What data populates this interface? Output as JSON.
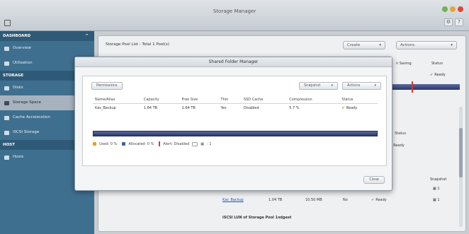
{
  "window": {
    "title": "Storage Manager"
  },
  "sidebar": {
    "dashboard_header": "DASHBOARD",
    "dashboard_items": [
      {
        "label": "Overview",
        "icon": "overview-icon"
      },
      {
        "label": "Utilization",
        "icon": "chart-icon"
      }
    ],
    "storage_header": "STORAGE",
    "storage_items": [
      {
        "label": "Disks",
        "icon": "disk-icon"
      },
      {
        "label": "Storage Space",
        "icon": "storage-icon",
        "active": true
      },
      {
        "label": "Cache Acceleration",
        "icon": "cache-icon"
      },
      {
        "label": "iSCSI Storage",
        "icon": "iscsi-icon"
      }
    ],
    "host_header": "HOST",
    "host_items": [
      {
        "label": "Hosts",
        "icon": "host-icon"
      }
    ]
  },
  "main": {
    "heading": "Storage Pool List - Total 1 Pool(s)",
    "create_label": "Create",
    "actions_label": "Actions",
    "right_col": {
      "saving_header": "n Saving",
      "status_header": "Status",
      "status_value": "Ready",
      "status_header2": "Status",
      "status_value2": "Ready",
      "snapshot_header": "Snapshot",
      "snapshot_val1": "1",
      "snapshot_val2": "1",
      "row_name": "Kas_Backup",
      "row_cap": "1.04 TB",
      "row_free": "10.50 MB",
      "row_thin": "No",
      "row_status": "Ready",
      "iscsi_label": "iSCSI LUN of Storage Pool 1xdgest"
    }
  },
  "modal": {
    "title": "Shared Folder Manager",
    "permissions_label": "Permissions",
    "snapshot_label": "Snapshot",
    "actions_label": "Actions",
    "close_label": "Close",
    "columns": [
      "Name/Alias",
      "Capacity",
      "Free Size",
      "Thin",
      "SSD Cache",
      "Compression",
      "Status"
    ],
    "rows": [
      {
        "name": "Kas_Backup",
        "capacity": "1.64 TB",
        "free": "1.64 TB",
        "thin": "Yes",
        "ssd_cache": "Disabled",
        "compression": "5.7 %",
        "status": "Ready"
      }
    ],
    "legend": {
      "used": "Used: 0 %",
      "allocated": "Allocated: 0 %",
      "alert": "Alert: Disabled",
      "snap": ": 1"
    },
    "colors": {
      "used": "#e8a020",
      "allocated": "#3a63a8",
      "alert": "#d43a2a"
    }
  }
}
